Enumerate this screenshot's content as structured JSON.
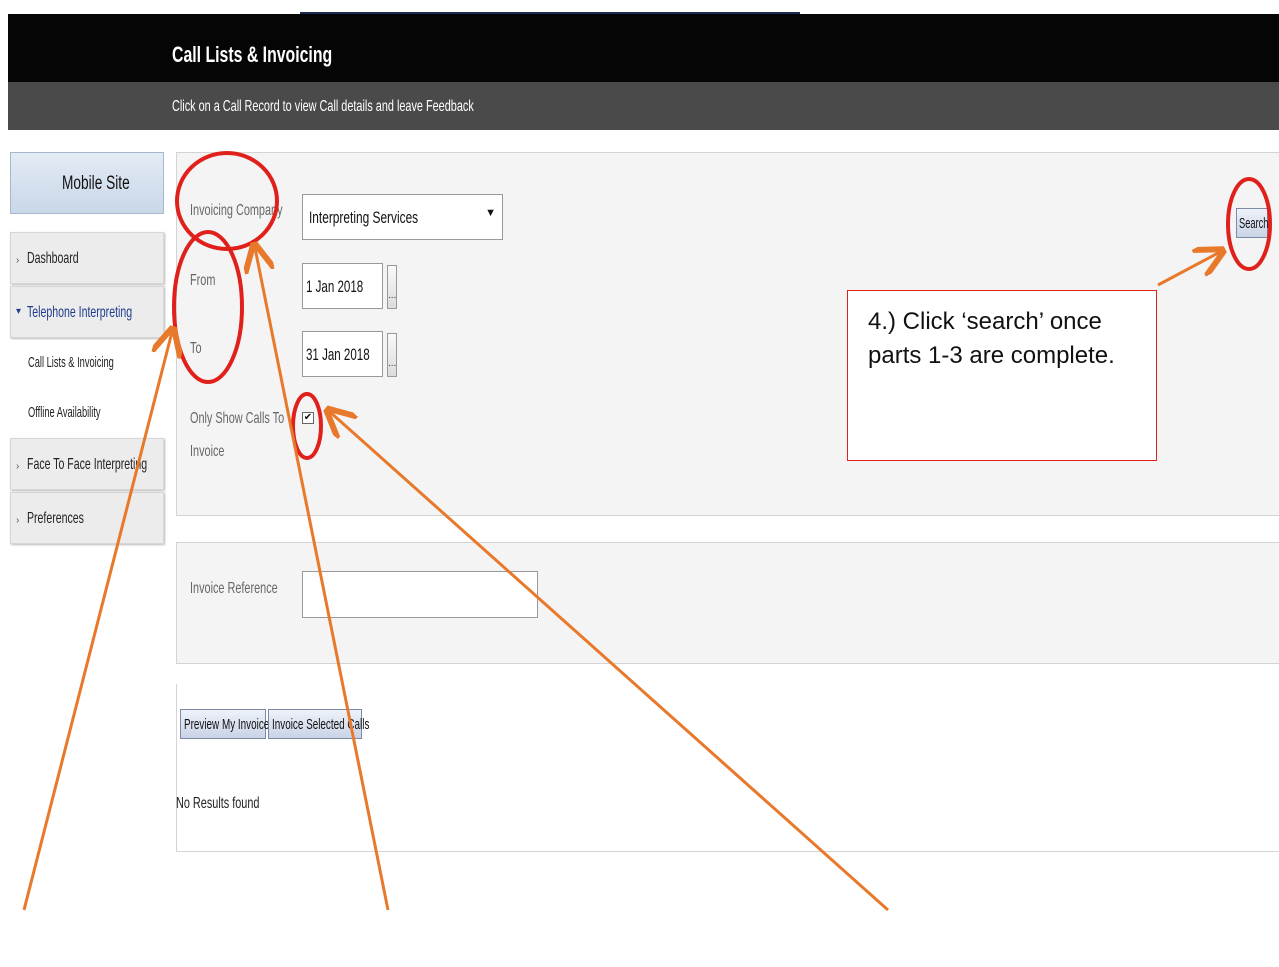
{
  "header": {
    "title": "Call Lists & Invoicing",
    "subtitle": "Click on a Call Record to view Call details and leave Feedback"
  },
  "sidebar": {
    "mobile_site": "Mobile Site",
    "items": [
      {
        "label": "Dashboard",
        "arrow": "›"
      },
      {
        "label": "Telephone Interpreting",
        "arrow": "▾"
      },
      {
        "label": "Face To Face Interpreting",
        "arrow": "›"
      },
      {
        "label": "Preferences",
        "arrow": "›"
      }
    ],
    "sub_items": [
      {
        "label": "Call Lists & Invoicing"
      },
      {
        "label": "Offline Availability"
      }
    ]
  },
  "form": {
    "invoicing_company_label": "Invoicing Company",
    "invoicing_company_value": "Interpreting Services",
    "from_label": "From",
    "from_value": "1 Jan 2018",
    "to_label": "To",
    "to_value": "31 Jan 2018",
    "date_picker_label": "...",
    "only_show_label_line1": "Only Show Calls To",
    "only_show_label_line2": "Invoice",
    "only_show_checked": "✔",
    "invoice_reference_label": "Invoice Reference",
    "invoice_reference_value": "",
    "search_label": "Search"
  },
  "actions": {
    "preview_label": "Preview My Invoice",
    "invoice_selected_label": "Invoice Selected Calls"
  },
  "results": {
    "empty_text": "No Results found"
  },
  "annotation": {
    "callout_text": "4.) Click ‘search’ once parts 1-3 are complete.",
    "circle_color": "#e0201b",
    "arrow_color": "#e8792b"
  }
}
